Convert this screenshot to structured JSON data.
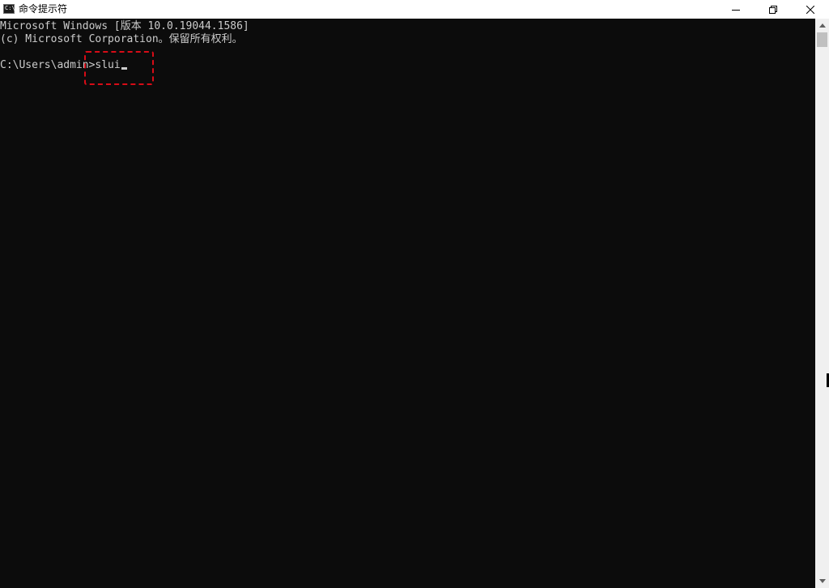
{
  "window": {
    "title": "命令提示符"
  },
  "icons": {
    "app": "console-app-icon",
    "minimize": "minimize-icon",
    "maximize": "restore-icon",
    "close": "close-icon",
    "scroll_up": "scroll-up-arrow-icon",
    "scroll_down": "scroll-down-arrow-icon"
  },
  "console": {
    "line1": "Microsoft Windows [版本 10.0.19044.1586]",
    "line2": "(c) Microsoft Corporation。保留所有权利。",
    "prompt": "C:\\Users\\admin>",
    "command": "slui"
  },
  "colors": {
    "console_bg": "#0c0c0c",
    "console_text": "#cccccc",
    "highlight": "#d80c17",
    "titlebar_bg": "#ffffff"
  }
}
